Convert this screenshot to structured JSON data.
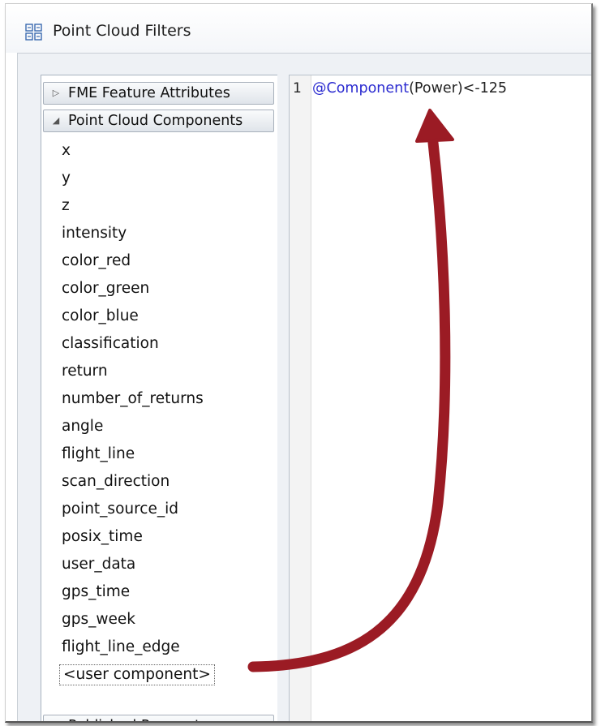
{
  "window": {
    "title": "Point Cloud Filters",
    "icon": "filter-grid-icon"
  },
  "tree": {
    "categories": [
      {
        "label": "FME Feature Attributes",
        "state": "collapsed"
      },
      {
        "label": "Point Cloud Components",
        "state": "expanded"
      },
      {
        "label": "Published Parameters",
        "state": "expanded"
      }
    ],
    "components": [
      "x",
      "y",
      "z",
      "intensity",
      "color_red",
      "color_green",
      "color_blue",
      "classification",
      "return",
      "number_of_returns",
      "angle",
      "flight_line",
      "scan_direction",
      "point_source_id",
      "posix_time",
      "user_data",
      "gps_time",
      "gps_week",
      "flight_line_edge"
    ],
    "user_component": "<user component>"
  },
  "editor": {
    "line_number": "1",
    "code_keyword": "@Component",
    "code_rest": "(Power)<-125"
  },
  "annotation": {
    "arrow_color": "#9b1b24"
  }
}
